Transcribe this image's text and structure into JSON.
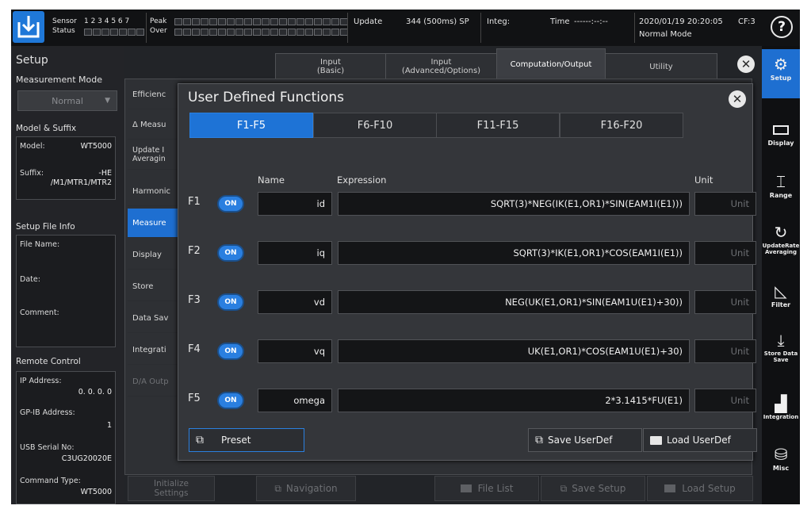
{
  "status_bar": {
    "sensor_label": "Sensor",
    "status_label": "Status",
    "sensor_numbers": "1 2 3 4 5 6 7",
    "peak_label": "Peak",
    "over_label": "Over",
    "update_label": "Update",
    "update_value": "344 (500ms) SP",
    "integ_label": "Integ:",
    "time_label": "Time",
    "time_value": "------:--:--",
    "date_time": "2020/01/19 20:20:05",
    "cf": "CF:3",
    "mode": "Normal Mode",
    "help_icon": "question-icon"
  },
  "setup_panel": {
    "title": "Setup",
    "measurement_mode_label": "Measurement Mode",
    "measurement_mode_value": "Normal",
    "model_suffix_label": "Model & Suffix",
    "model_label": "Model:",
    "model_value": "WT5000",
    "suffix_label": "Suffix:",
    "suffix_value_1": "-HE",
    "suffix_value_2": "/M1/MTR1/MTR2",
    "setup_file_info_label": "Setup File Info",
    "file_name_label": "File Name:",
    "date_label": "Date:",
    "comment_label": "Comment:",
    "remote_control_label": "Remote Control",
    "ip_address_label": "IP Address:",
    "ip_address_value": "0. 0. 0. 0",
    "gpib_address_label": "GP-IB Address:",
    "gpib_address_value": "1",
    "usb_serial_label": "USB Serial No:",
    "usb_serial_value": "C3UG20020E",
    "command_type_label": "Command Type:",
    "command_type_value": "WT5000"
  },
  "top_tabs": [
    {
      "label": "Input",
      "sub": "(Basic)"
    },
    {
      "label": "Input",
      "sub": "(Advanced/Options)"
    },
    {
      "label": "Computation/Output",
      "sub": ""
    },
    {
      "label": "Utility",
      "sub": ""
    }
  ],
  "side_menu": [
    "Efficienc",
    "Δ Measu",
    "Update I Averagin",
    "Harmonic",
    "Measure",
    "Display",
    "Store",
    "Data Sav",
    "Integrati",
    "D/A Outp"
  ],
  "dialog": {
    "title": "User Defined Functions",
    "tabs": [
      "F1-F5",
      "F6-F10",
      "F11-F15",
      "F16-F20"
    ],
    "col_name": "Name",
    "col_expression": "Expression",
    "col_unit": "Unit",
    "functions": [
      {
        "label": "F1",
        "state": "ON",
        "name": "id",
        "expression": "SQRT(3)*NEG(IK(E1,OR1)*SIN(EAM1I(E1)))",
        "unit": "Unit"
      },
      {
        "label": "F2",
        "state": "ON",
        "name": "iq",
        "expression": "SQRT(3)*IK(E1,OR1)*COS(EAM1I(E1))",
        "unit": "Unit"
      },
      {
        "label": "F3",
        "state": "ON",
        "name": "vd",
        "expression": "NEG(UK(E1,OR1)*SIN(EAM1U(E1)+30))",
        "unit": "Unit"
      },
      {
        "label": "F4",
        "state": "ON",
        "name": "vq",
        "expression": "UK(E1,OR1)*COS(EAM1U(E1)+30)",
        "unit": "Unit"
      },
      {
        "label": "F5",
        "state": "ON",
        "name": "omega",
        "expression": "2*3.1415*FU(E1)",
        "unit": "Unit"
      }
    ],
    "preset_label": "Preset",
    "save_label": "Save UserDef",
    "load_label": "Load UserDef"
  },
  "bottom_bar": {
    "initialize": "Initialize Settings",
    "navigation": "Navigation",
    "file_list": "File List",
    "save_setup": "Save Setup",
    "load_setup": "Load Setup"
  },
  "right_toolbar": [
    {
      "label": "Setup",
      "icon": "gear-icon"
    },
    {
      "label": "Display",
      "icon": "display-icon"
    },
    {
      "label": "Range",
      "icon": "range-icon"
    },
    {
      "label": "UpdateRate Averaging",
      "icon": "refresh-icon"
    },
    {
      "label": "Filter",
      "icon": "filter-icon"
    },
    {
      "label": "Store Data Save",
      "icon": "store-icon"
    },
    {
      "label": "Integration",
      "icon": "integration-icon"
    },
    {
      "label": "Misc",
      "icon": "misc-icon"
    }
  ]
}
